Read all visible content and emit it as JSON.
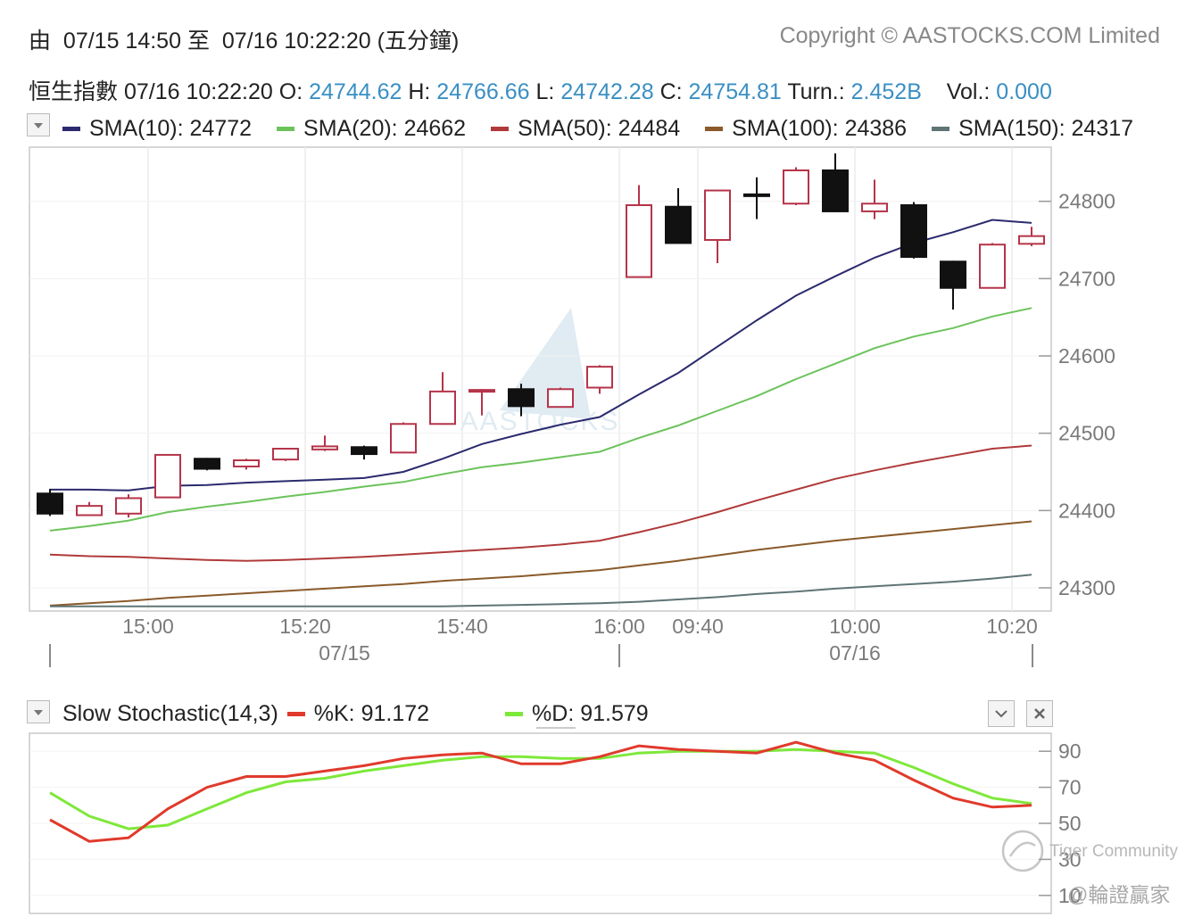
{
  "header": {
    "range_prefix": "由",
    "range_from": "07/15 14:50",
    "range_mid": "至",
    "range_to": "07/16 10:22:20",
    "range_interval": "(五分鐘)",
    "copyright": "Copyright © AASTOCKS.COM Limited"
  },
  "quote": {
    "name": "恒生指數",
    "datetime": "07/16 10:22:20",
    "open_label": "O:",
    "open": "24744.62",
    "high_label": "H:",
    "high": "24766.66",
    "low_label": "L:",
    "low": "24742.28",
    "close_label": "C:",
    "close": "24754.81",
    "turn_label": "Turn.:",
    "turn": "2.452B",
    "vol_label": "Vol.:",
    "vol": "0.000"
  },
  "sma_legend": [
    {
      "label": "SMA(10): 24772",
      "color": "#2b2a6e"
    },
    {
      "label": "SMA(20): 24662",
      "color": "#6cc35c"
    },
    {
      "label": "SMA(50): 24484",
      "color": "#b03a3a"
    },
    {
      "label": "SMA(100): 24386",
      "color": "#8a5a2a"
    },
    {
      "label": "SMA(150): 24317",
      "color": "#5f7475"
    }
  ],
  "stoch_legend": {
    "title": "Slow Stochastic(14,3)",
    "k_label": "%K: 91.172",
    "d_label": "%D: 91.579",
    "k_color": "#e03a2c",
    "d_color": "#7ee83a"
  },
  "watermark": {
    "logo_text": "AASTOCKS",
    "community": "Tiger Community",
    "handle": "@輪證贏家"
  },
  "colors": {
    "up_candle": "#b5344a",
    "down_candle": "#111111",
    "price_text": "#3a8fc4"
  },
  "chart_data": [
    {
      "type": "candlestick",
      "title": "",
      "ylim": [
        24270,
        24870
      ],
      "yticks": [
        24300,
        24400,
        24500,
        24600,
        24700,
        24800
      ],
      "x_tick_labels": [
        {
          "index": 2.5,
          "label": "15:00"
        },
        {
          "index": 6.5,
          "label": "15:20"
        },
        {
          "index": 10.5,
          "label": "15:40"
        },
        {
          "index": 14.5,
          "label": "16:00"
        },
        {
          "index": 16.5,
          "label": "09:40"
        },
        {
          "index": 20.5,
          "label": "10:00"
        },
        {
          "index": 24.5,
          "label": "10:20"
        }
      ],
      "date_labels": [
        {
          "index": 7.5,
          "label": "07/15"
        },
        {
          "index": 20.5,
          "label": "07/16"
        }
      ],
      "candles": [
        {
          "o": 24422,
          "h": 24428,
          "l": 24393,
          "c": 24396
        },
        {
          "o": 24394,
          "h": 24411,
          "l": 24393,
          "c": 24406
        },
        {
          "o": 24396,
          "h": 24421,
          "l": 24391,
          "c": 24416
        },
        {
          "o": 24417,
          "h": 24473,
          "l": 24416,
          "c": 24472
        },
        {
          "o": 24467,
          "h": 24468,
          "l": 24452,
          "c": 24454
        },
        {
          "o": 24457,
          "h": 24467,
          "l": 24453,
          "c": 24465
        },
        {
          "o": 24466,
          "h": 24481,
          "l": 24464,
          "c": 24480
        },
        {
          "o": 24479,
          "h": 24497,
          "l": 24477,
          "c": 24483
        },
        {
          "o": 24482,
          "h": 24484,
          "l": 24466,
          "c": 24473
        },
        {
          "o": 24475,
          "h": 24514,
          "l": 24474,
          "c": 24512
        },
        {
          "o": 24512,
          "h": 24579,
          "l": 24511,
          "c": 24554
        },
        {
          "o": 24554,
          "h": 24557,
          "l": 24523,
          "c": 24556
        },
        {
          "o": 24557,
          "h": 24564,
          "l": 24522,
          "c": 24535
        },
        {
          "o": 24534,
          "h": 24559,
          "l": 24534,
          "c": 24557
        },
        {
          "o": 24559,
          "h": 24588,
          "l": 24551,
          "c": 24586
        },
        {
          "o": 24702,
          "h": 24821,
          "l": 24701,
          "c": 24795
        },
        {
          "o": 24793,
          "h": 24817,
          "l": 24748,
          "c": 24746
        },
        {
          "o": 24750,
          "h": 24815,
          "l": 24720,
          "c": 24814
        },
        {
          "o": 24809,
          "h": 24831,
          "l": 24777,
          "c": 24807
        },
        {
          "o": 24797,
          "h": 24844,
          "l": 24795,
          "c": 24840
        },
        {
          "o": 24840,
          "h": 24862,
          "l": 24786,
          "c": 24787
        },
        {
          "o": 24787,
          "h": 24828,
          "l": 24777,
          "c": 24797
        },
        {
          "o": 24795,
          "h": 24799,
          "l": 24726,
          "c": 24728
        },
        {
          "o": 24722,
          "h": 24723,
          "l": 24660,
          "c": 24688
        },
        {
          "o": 24688,
          "h": 24746,
          "l": 24687,
          "c": 24744
        },
        {
          "o": 24745,
          "h": 24767,
          "l": 24742,
          "c": 24755
        }
      ],
      "series": [
        {
          "name": "SMA(10)",
          "color": "#2b2a6e",
          "values": [
            24427,
            24427,
            24426,
            24432,
            24433,
            24436,
            24438,
            24440,
            24442,
            24450,
            24467,
            24486,
            24499,
            24511,
            24521,
            24550,
            24578,
            24612,
            24646,
            24678,
            24703,
            24727,
            24746,
            24760,
            24776,
            24772
          ]
        },
        {
          "name": "SMA(20)",
          "color": "#6cc35c",
          "values": [
            24374,
            24380,
            24387,
            24398,
            24405,
            24411,
            24418,
            24424,
            24431,
            24437,
            24447,
            24456,
            24462,
            24469,
            24476,
            24494,
            24510,
            24529,
            24548,
            24570,
            24590,
            24610,
            24625,
            24636,
            24651,
            24662
          ]
        },
        {
          "name": "SMA(50)",
          "color": "#b03a3a",
          "values": [
            24343,
            24341,
            24340,
            24338,
            24336,
            24335,
            24336,
            24338,
            24340,
            24343,
            24346,
            24349,
            24352,
            24356,
            24361,
            24372,
            24384,
            24398,
            24413,
            24427,
            24441,
            24452,
            24462,
            24471,
            24480,
            24484
          ]
        },
        {
          "name": "SMA(100)",
          "color": "#8a5a2a",
          "values": [
            24277,
            24280,
            24283,
            24287,
            24290,
            24293,
            24296,
            24299,
            24302,
            24305,
            24309,
            24312,
            24315,
            24319,
            24323,
            24329,
            24335,
            24342,
            24349,
            24355,
            24361,
            24366,
            24371,
            24376,
            24381,
            24386
          ]
        },
        {
          "name": "SMA(150)",
          "color": "#5f7475",
          "values": [
            24276,
            24276,
            24276,
            24276,
            24276,
            24276,
            24276,
            24276,
            24276,
            24276,
            24276,
            24277,
            24278,
            24279,
            24280,
            24282,
            24285,
            24288,
            24292,
            24295,
            24299,
            24302,
            24305,
            24308,
            24312,
            24317
          ]
        }
      ]
    },
    {
      "type": "line",
      "title": "",
      "ylim": [
        0,
        100
      ],
      "yticks": [
        10,
        30,
        50,
        70,
        90
      ],
      "series": [
        {
          "name": "%K",
          "color": "#e03a2c",
          "values": [
            52,
            40,
            42,
            58,
            70,
            76,
            76,
            79,
            82,
            86,
            88,
            89,
            83,
            83,
            87,
            93,
            91,
            90,
            89,
            95,
            89,
            85,
            74,
            64,
            59,
            60
          ]
        },
        {
          "name": "%D",
          "color": "#7ee83a",
          "values": [
            67,
            54,
            47,
            49,
            58,
            67,
            73,
            75,
            79,
            82,
            85,
            87,
            87,
            86,
            86,
            89,
            90,
            90,
            90,
            91,
            90,
            89,
            81,
            72,
            64,
            61
          ]
        }
      ]
    }
  ]
}
